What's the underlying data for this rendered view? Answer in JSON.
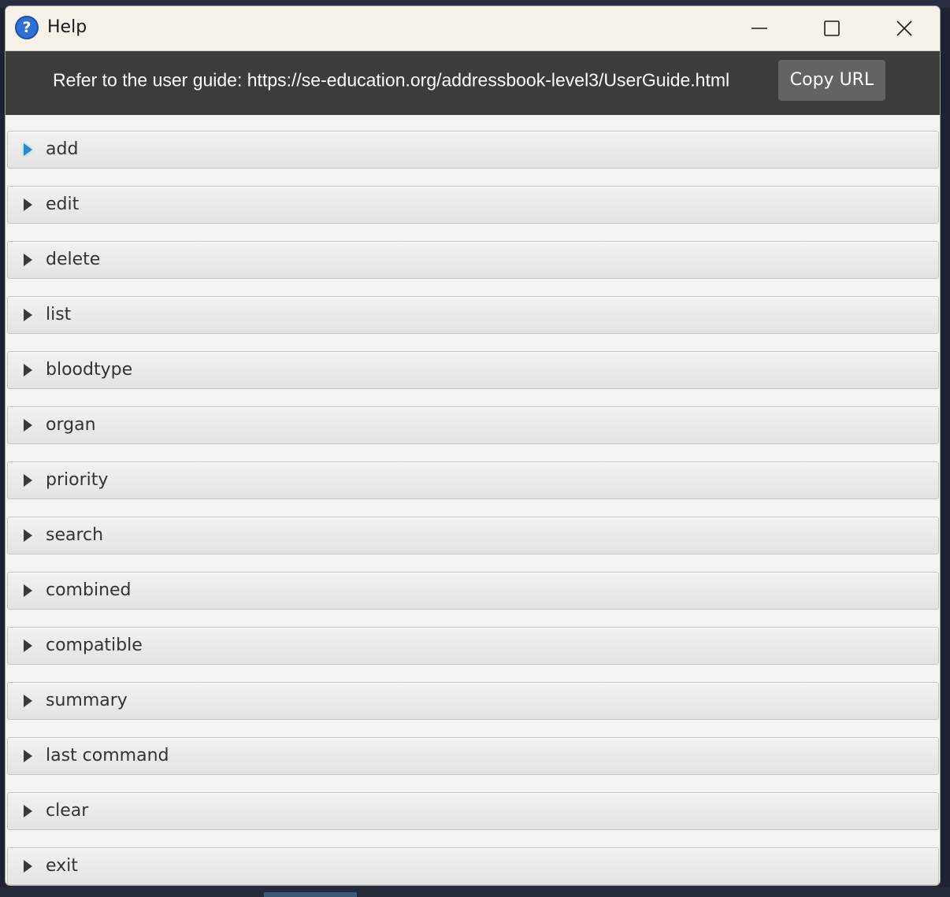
{
  "window": {
    "title": "Help",
    "app_icon": "question-mark-icon"
  },
  "header": {
    "guide_text": "Refer to the user guide: https://se-education.org/addressbook-level3/UserGuide.html",
    "copy_button_label": "Copy URL"
  },
  "commands": [
    {
      "label": "add"
    },
    {
      "label": "edit"
    },
    {
      "label": "delete"
    },
    {
      "label": "list"
    },
    {
      "label": "bloodtype"
    },
    {
      "label": "organ"
    },
    {
      "label": "priority"
    },
    {
      "label": "search"
    },
    {
      "label": "combined"
    },
    {
      "label": "compatible"
    },
    {
      "label": "summary"
    },
    {
      "label": "last command"
    },
    {
      "label": "clear"
    },
    {
      "label": "exit"
    }
  ],
  "colors": {
    "titlebar_bg": "#f7f2e8",
    "urlbar_bg": "#3c3c3c",
    "copy_button_bg": "#636363",
    "focus_accent": "#2a8ac8"
  }
}
